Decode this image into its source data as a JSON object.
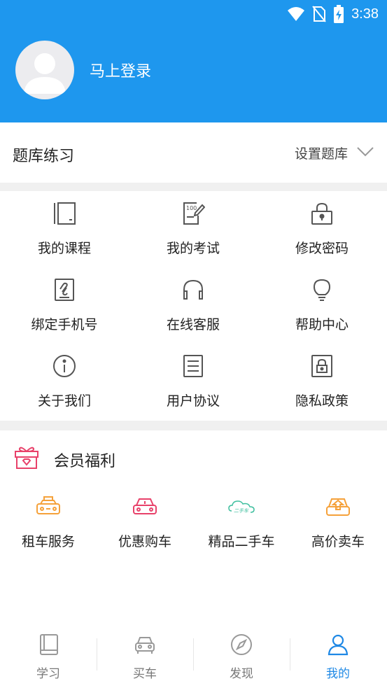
{
  "status_bar": {
    "time": "3:38"
  },
  "header": {
    "login_text": "马上登录",
    "background": "#1e97ee"
  },
  "question_bank": {
    "title": "题库练习",
    "settings_label": "设置题库"
  },
  "menu_grid": [
    {
      "label": "我的课程",
      "icon": "course-book-icon"
    },
    {
      "label": "我的考试",
      "icon": "exam-paper-icon"
    },
    {
      "label": "修改密码",
      "icon": "lock-icon"
    },
    {
      "label": "绑定手机号",
      "icon": "phone-link-icon"
    },
    {
      "label": "在线客服",
      "icon": "headset-icon"
    },
    {
      "label": "帮助中心",
      "icon": "lightbulb-icon"
    },
    {
      "label": "关于我们",
      "icon": "info-icon"
    },
    {
      "label": "用户协议",
      "icon": "document-icon"
    },
    {
      "label": "隐私政策",
      "icon": "privacy-lock-icon"
    }
  ],
  "member": {
    "title": "会员福利",
    "benefits": [
      {
        "label": "租车服务",
        "icon": "taxi-icon",
        "color": "#f5a13a"
      },
      {
        "label": "优惠购车",
        "icon": "car-icon",
        "color": "#e8416a"
      },
      {
        "label": "精品二手车",
        "icon": "used-car-cloud-icon",
        "color": "#3fbf9f"
      },
      {
        "label": "高价卖车",
        "icon": "sell-car-icon",
        "color": "#f5a13a"
      }
    ]
  },
  "tabbar": {
    "tabs": [
      {
        "label": "学习",
        "icon": "book-icon"
      },
      {
        "label": "买车",
        "icon": "car-front-icon"
      },
      {
        "label": "发现",
        "icon": "compass-icon"
      },
      {
        "label": "我的",
        "icon": "person-icon"
      }
    ],
    "active_index": 3,
    "active_color": "#1e88e5"
  }
}
